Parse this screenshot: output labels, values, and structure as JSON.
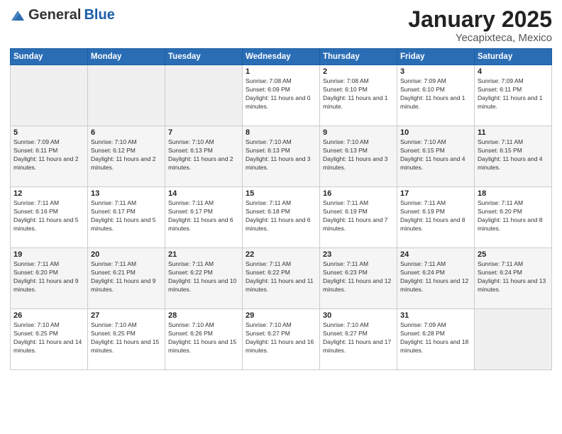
{
  "header": {
    "logo_general": "General",
    "logo_blue": "Blue",
    "month_title": "January 2025",
    "location": "Yecapixteca, Mexico"
  },
  "weekdays": [
    "Sunday",
    "Monday",
    "Tuesday",
    "Wednesday",
    "Thursday",
    "Friday",
    "Saturday"
  ],
  "weeks": [
    [
      {
        "day": "",
        "sunrise": "",
        "sunset": "",
        "daylight": ""
      },
      {
        "day": "",
        "sunrise": "",
        "sunset": "",
        "daylight": ""
      },
      {
        "day": "",
        "sunrise": "",
        "sunset": "",
        "daylight": ""
      },
      {
        "day": "1",
        "sunrise": "Sunrise: 7:08 AM",
        "sunset": "Sunset: 6:09 PM",
        "daylight": "Daylight: 11 hours and 0 minutes."
      },
      {
        "day": "2",
        "sunrise": "Sunrise: 7:08 AM",
        "sunset": "Sunset: 6:10 PM",
        "daylight": "Daylight: 11 hours and 1 minute."
      },
      {
        "day": "3",
        "sunrise": "Sunrise: 7:09 AM",
        "sunset": "Sunset: 6:10 PM",
        "daylight": "Daylight: 11 hours and 1 minute."
      },
      {
        "day": "4",
        "sunrise": "Sunrise: 7:09 AM",
        "sunset": "Sunset: 6:11 PM",
        "daylight": "Daylight: 11 hours and 1 minute."
      }
    ],
    [
      {
        "day": "5",
        "sunrise": "Sunrise: 7:09 AM",
        "sunset": "Sunset: 6:11 PM",
        "daylight": "Daylight: 11 hours and 2 minutes."
      },
      {
        "day": "6",
        "sunrise": "Sunrise: 7:10 AM",
        "sunset": "Sunset: 6:12 PM",
        "daylight": "Daylight: 11 hours and 2 minutes."
      },
      {
        "day": "7",
        "sunrise": "Sunrise: 7:10 AM",
        "sunset": "Sunset: 6:13 PM",
        "daylight": "Daylight: 11 hours and 2 minutes."
      },
      {
        "day": "8",
        "sunrise": "Sunrise: 7:10 AM",
        "sunset": "Sunset: 6:13 PM",
        "daylight": "Daylight: 11 hours and 3 minutes."
      },
      {
        "day": "9",
        "sunrise": "Sunrise: 7:10 AM",
        "sunset": "Sunset: 6:13 PM",
        "daylight": "Daylight: 11 hours and 3 minutes."
      },
      {
        "day": "10",
        "sunrise": "Sunrise: 7:10 AM",
        "sunset": "Sunset: 6:15 PM",
        "daylight": "Daylight: 11 hours and 4 minutes."
      },
      {
        "day": "11",
        "sunrise": "Sunrise: 7:11 AM",
        "sunset": "Sunset: 6:15 PM",
        "daylight": "Daylight: 11 hours and 4 minutes."
      }
    ],
    [
      {
        "day": "12",
        "sunrise": "Sunrise: 7:11 AM",
        "sunset": "Sunset: 6:16 PM",
        "daylight": "Daylight: 11 hours and 5 minutes."
      },
      {
        "day": "13",
        "sunrise": "Sunrise: 7:11 AM",
        "sunset": "Sunset: 6:17 PM",
        "daylight": "Daylight: 11 hours and 5 minutes."
      },
      {
        "day": "14",
        "sunrise": "Sunrise: 7:11 AM",
        "sunset": "Sunset: 6:17 PM",
        "daylight": "Daylight: 11 hours and 6 minutes."
      },
      {
        "day": "15",
        "sunrise": "Sunrise: 7:11 AM",
        "sunset": "Sunset: 6:18 PM",
        "daylight": "Daylight: 11 hours and 6 minutes."
      },
      {
        "day": "16",
        "sunrise": "Sunrise: 7:11 AM",
        "sunset": "Sunset: 6:19 PM",
        "daylight": "Daylight: 11 hours and 7 minutes."
      },
      {
        "day": "17",
        "sunrise": "Sunrise: 7:11 AM",
        "sunset": "Sunset: 6:19 PM",
        "daylight": "Daylight: 11 hours and 8 minutes."
      },
      {
        "day": "18",
        "sunrise": "Sunrise: 7:11 AM",
        "sunset": "Sunset: 6:20 PM",
        "daylight": "Daylight: 11 hours and 8 minutes."
      }
    ],
    [
      {
        "day": "19",
        "sunrise": "Sunrise: 7:11 AM",
        "sunset": "Sunset: 6:20 PM",
        "daylight": "Daylight: 11 hours and 9 minutes."
      },
      {
        "day": "20",
        "sunrise": "Sunrise: 7:11 AM",
        "sunset": "Sunset: 6:21 PM",
        "daylight": "Daylight: 11 hours and 9 minutes."
      },
      {
        "day": "21",
        "sunrise": "Sunrise: 7:11 AM",
        "sunset": "Sunset: 6:22 PM",
        "daylight": "Daylight: 11 hours and 10 minutes."
      },
      {
        "day": "22",
        "sunrise": "Sunrise: 7:11 AM",
        "sunset": "Sunset: 6:22 PM",
        "daylight": "Daylight: 11 hours and 11 minutes."
      },
      {
        "day": "23",
        "sunrise": "Sunrise: 7:11 AM",
        "sunset": "Sunset: 6:23 PM",
        "daylight": "Daylight: 11 hours and 12 minutes."
      },
      {
        "day": "24",
        "sunrise": "Sunrise: 7:11 AM",
        "sunset": "Sunset: 6:24 PM",
        "daylight": "Daylight: 11 hours and 12 minutes."
      },
      {
        "day": "25",
        "sunrise": "Sunrise: 7:11 AM",
        "sunset": "Sunset: 6:24 PM",
        "daylight": "Daylight: 11 hours and 13 minutes."
      }
    ],
    [
      {
        "day": "26",
        "sunrise": "Sunrise: 7:10 AM",
        "sunset": "Sunset: 6:25 PM",
        "daylight": "Daylight: 11 hours and 14 minutes."
      },
      {
        "day": "27",
        "sunrise": "Sunrise: 7:10 AM",
        "sunset": "Sunset: 6:25 PM",
        "daylight": "Daylight: 11 hours and 15 minutes."
      },
      {
        "day": "28",
        "sunrise": "Sunrise: 7:10 AM",
        "sunset": "Sunset: 6:26 PM",
        "daylight": "Daylight: 11 hours and 15 minutes."
      },
      {
        "day": "29",
        "sunrise": "Sunrise: 7:10 AM",
        "sunset": "Sunset: 6:27 PM",
        "daylight": "Daylight: 11 hours and 16 minutes."
      },
      {
        "day": "30",
        "sunrise": "Sunrise: 7:10 AM",
        "sunset": "Sunset: 6:27 PM",
        "daylight": "Daylight: 11 hours and 17 minutes."
      },
      {
        "day": "31",
        "sunrise": "Sunrise: 7:09 AM",
        "sunset": "Sunset: 6:28 PM",
        "daylight": "Daylight: 11 hours and 18 minutes."
      },
      {
        "day": "",
        "sunrise": "",
        "sunset": "",
        "daylight": ""
      }
    ]
  ]
}
